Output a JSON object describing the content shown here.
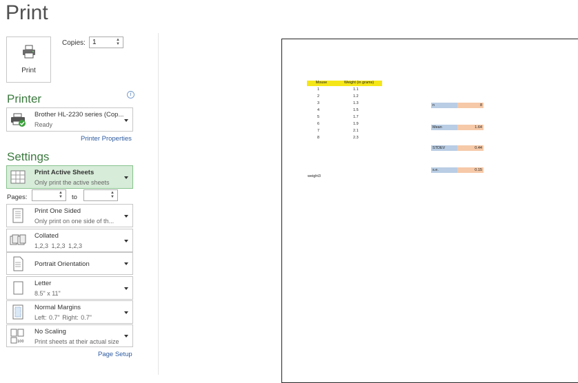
{
  "title": "Print",
  "print_button": {
    "label": "Print",
    "icon": "printer-icon"
  },
  "copies": {
    "label": "Copies:",
    "value": "1"
  },
  "printer": {
    "heading": "Printer",
    "name": "Brother HL-2230 series (Cop...",
    "status": "Ready",
    "properties_link": "Printer Properties"
  },
  "settings": {
    "heading": "Settings",
    "options": [
      {
        "title": "Print Active Sheets",
        "sub": "Only print the active sheets",
        "icon": "sheets-grid-icon"
      },
      {
        "title": "Print One Sided",
        "sub": "Only print on one side of th...",
        "icon": "one-sided-icon"
      },
      {
        "title": "Collated",
        "sub": "1,2,3    1,2,3    1,2,3",
        "icon": "collated-icon"
      },
      {
        "title": "Portrait Orientation",
        "sub": "",
        "icon": "portrait-icon"
      },
      {
        "title": "Letter",
        "sub": "8.5\" x 11\"",
        "icon": "paper-size-icon"
      },
      {
        "title": "Normal Margins",
        "sub": "Left:  0.7\"    Right:  0.7\"",
        "icon": "margins-icon"
      },
      {
        "title": "No Scaling",
        "sub": "Print sheets at their actual size",
        "icon": "scaling-icon"
      }
    ],
    "pages_label": "Pages:",
    "to_label": "to",
    "page_setup_link": "Page Setup"
  },
  "preview": {
    "table_headers": [
      "Mouse",
      "Weight (in grams)"
    ],
    "rows": [
      [
        "1",
        "1.1"
      ],
      [
        "2",
        "1.2"
      ],
      [
        "3",
        "1.3"
      ],
      [
        "4",
        "1.5"
      ],
      [
        "5",
        "1.7"
      ],
      [
        "6",
        "1.9"
      ],
      [
        "7",
        "2.1"
      ],
      [
        "8",
        "2.3"
      ]
    ],
    "stats": [
      {
        "label": "n",
        "value": "8"
      },
      {
        "label": "Mean",
        "value": "1.64"
      },
      {
        "label": "STDEV",
        "value": "0.44"
      },
      {
        "label": "s.e.",
        "value": "0.15"
      }
    ],
    "sheet_name": "weight3"
  },
  "colors": {
    "accent_green": "#3b7a3e",
    "selected_bg": "#d7ecd9",
    "link_blue": "#2c5aa0",
    "header_yellow": "#f5e617"
  }
}
